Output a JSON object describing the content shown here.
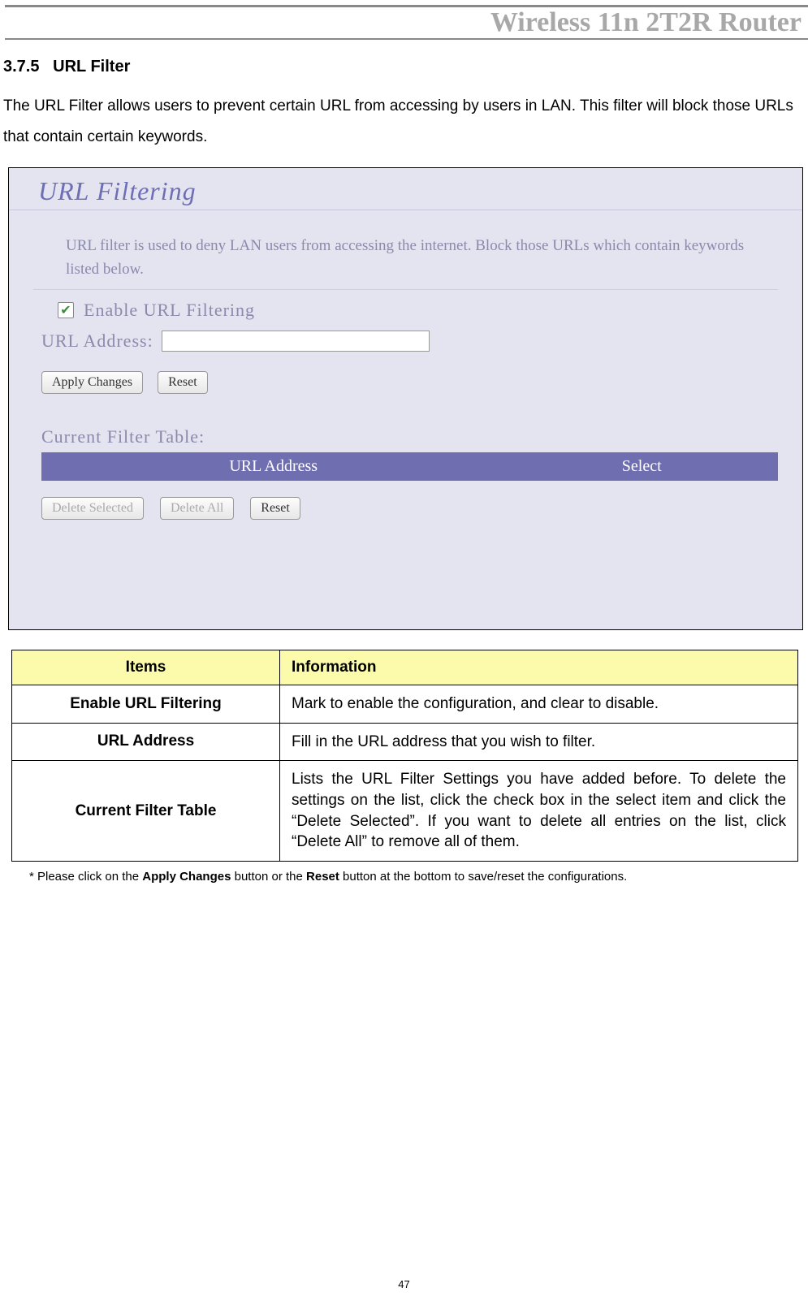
{
  "header": {
    "title": "Wireless 11n 2T2R Router"
  },
  "section": {
    "number": "3.7.5",
    "title": "URL Filter",
    "intro": "The URL Filter allows users to prevent certain URL from accessing by users in LAN. This filter will block those URLs that contain certain keywords."
  },
  "screenshot": {
    "panel_title": "URL Filtering",
    "description": "URL filter is used to deny LAN users from accessing the internet. Block those URLs which contain keywords listed below.",
    "enable_label": "Enable URL Filtering",
    "enable_checked": true,
    "url_label": "URL Address:",
    "url_value": "",
    "buttons": {
      "apply": "Apply Changes",
      "reset": "Reset",
      "delete_selected": "Delete Selected",
      "delete_all": "Delete All",
      "reset2": "Reset"
    },
    "table_title": "Current Filter Table:",
    "columns": {
      "col1": "URL Address",
      "col2": "Select"
    }
  },
  "info_table": {
    "headers": {
      "items": "Items",
      "info": "Information"
    },
    "rows": [
      {
        "item": "Enable URL Filtering",
        "info": "Mark to enable the configuration, and clear to disable."
      },
      {
        "item": "URL Address",
        "info": "Fill in the URL address that you wish to filter."
      },
      {
        "item": "Current Filter Table",
        "info": "Lists the URL Filter Settings you have added before. To delete the settings on the list, click the check box in the select item and click the “Delete Selected”. If you want to delete all entries on the list, click “Delete All” to remove all of them."
      }
    ]
  },
  "note": {
    "prefix": "* Please click on the ",
    "bold1": "Apply Changes",
    "mid": " button or the ",
    "bold2": "Reset",
    "suffix": " button at the bottom to save/reset the configurations."
  },
  "page_number": "47"
}
